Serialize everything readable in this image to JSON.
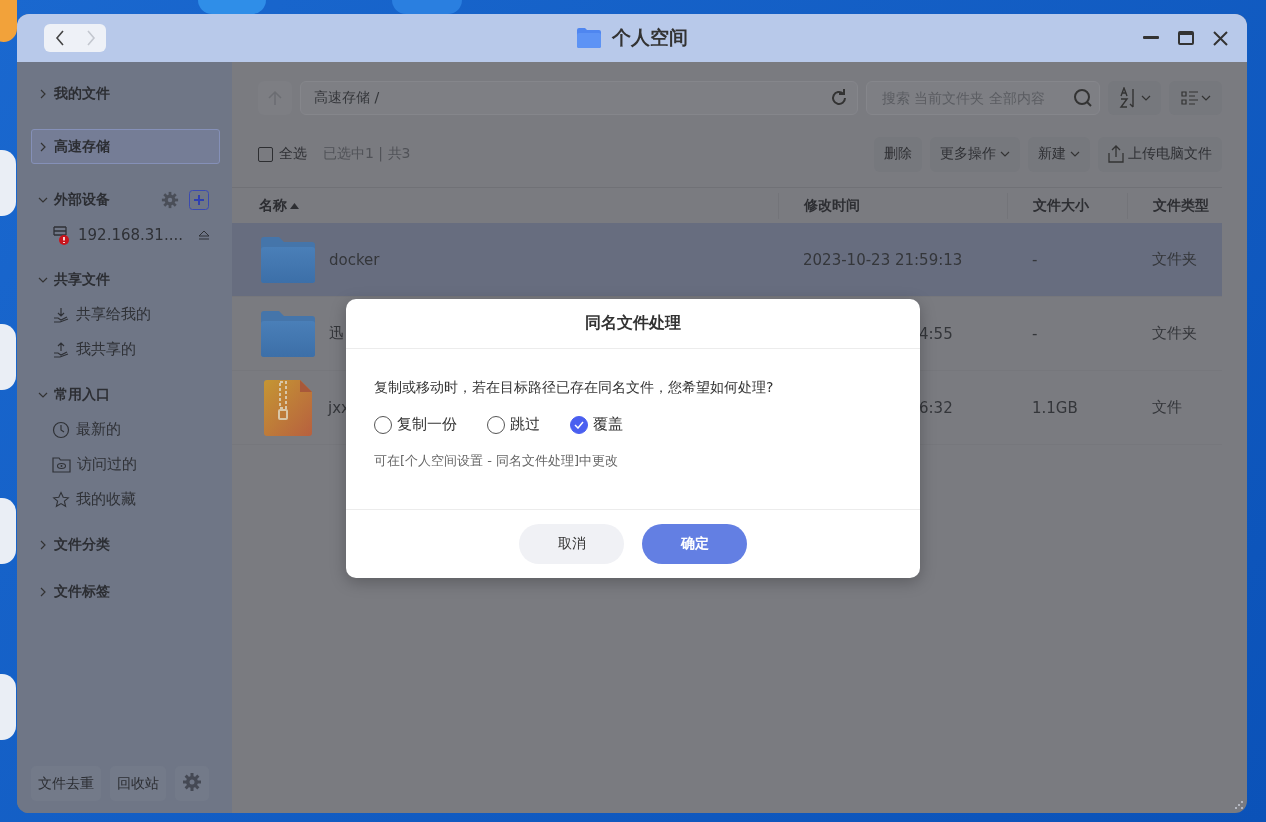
{
  "window": {
    "title": "个人空间",
    "nav": [
      {
        "kind": "back",
        "disabled": false
      },
      {
        "kind": "forward",
        "disabled": true
      }
    ]
  },
  "sidebar": {
    "sections": [
      {
        "label": "我的文件",
        "expanded": false,
        "selected": false
      },
      {
        "label": "高速存储",
        "expanded": false,
        "selected": true
      },
      {
        "label": "外部设备",
        "expanded": true,
        "selected": false,
        "kind": "devices",
        "children": [
          {
            "label": "192.168.31....",
            "warning": true
          }
        ]
      },
      {
        "label": "共享文件",
        "expanded": true,
        "selected": false,
        "children": [
          {
            "label": "共享给我的"
          },
          {
            "label": "我共享的"
          }
        ]
      },
      {
        "label": "常用入口",
        "expanded": true,
        "selected": false,
        "children": [
          {
            "label": "最新的"
          },
          {
            "label": "访问过的"
          },
          {
            "label": "我的收藏"
          }
        ]
      },
      {
        "label": "文件分类",
        "expanded": false,
        "selected": false
      },
      {
        "label": "文件标签",
        "expanded": false,
        "selected": false
      }
    ],
    "footer": [
      "文件去重",
      "回收站"
    ]
  },
  "toolbar": {
    "path": "高速存储 /",
    "search": {
      "placeholder": "搜索 当前文件夹 全部内容"
    },
    "select_all": {
      "label": "全选",
      "checked": false
    },
    "count": "已选中1 | 共3",
    "buttons": [
      {
        "label": "删除",
        "kind": "plain"
      },
      {
        "label": "更多操作",
        "kind": "menu"
      },
      {
        "label": "新建",
        "kind": "menu"
      },
      {
        "label": "上传电脑文件",
        "kind": "upload"
      }
    ]
  },
  "table": {
    "columns": [
      {
        "label": "名称",
        "sorted": true
      },
      {
        "label": "修改时间",
        "sorted": false
      },
      {
        "label": "文件大小",
        "sorted": false
      },
      {
        "label": "文件类型",
        "sorted": false
      }
    ],
    "rows": [
      {
        "kind": "folder",
        "selected": true,
        "covered": false,
        "name": "docker",
        "modified": "2023-10-23 21:59:13",
        "size": "-",
        "type": "文件夹"
      },
      {
        "kind": "folder",
        "selected": false,
        "covered": true,
        "name": "迅",
        "modified": "4:55",
        "size": "-",
        "type": "文件夹"
      },
      {
        "kind": "archive",
        "selected": false,
        "covered": true,
        "name": "jxx",
        "modified": "6:32",
        "size": "1.1GB",
        "type": "文件"
      }
    ]
  },
  "dialog": {
    "title": "同名文件处理",
    "message": "复制或移动时，若在目标路径已存在同名文件，您希望如何处理?",
    "options": [
      {
        "label": "复制一份",
        "selected": false
      },
      {
        "label": "跳过",
        "selected": false
      },
      {
        "label": "覆盖",
        "selected": true
      }
    ],
    "hint": "可在[个人空间设置 - 同名文件处理]中更改",
    "buttons": [
      {
        "label": "取消",
        "kind": "secondary"
      },
      {
        "label": "确定",
        "kind": "primary"
      }
    ]
  }
}
